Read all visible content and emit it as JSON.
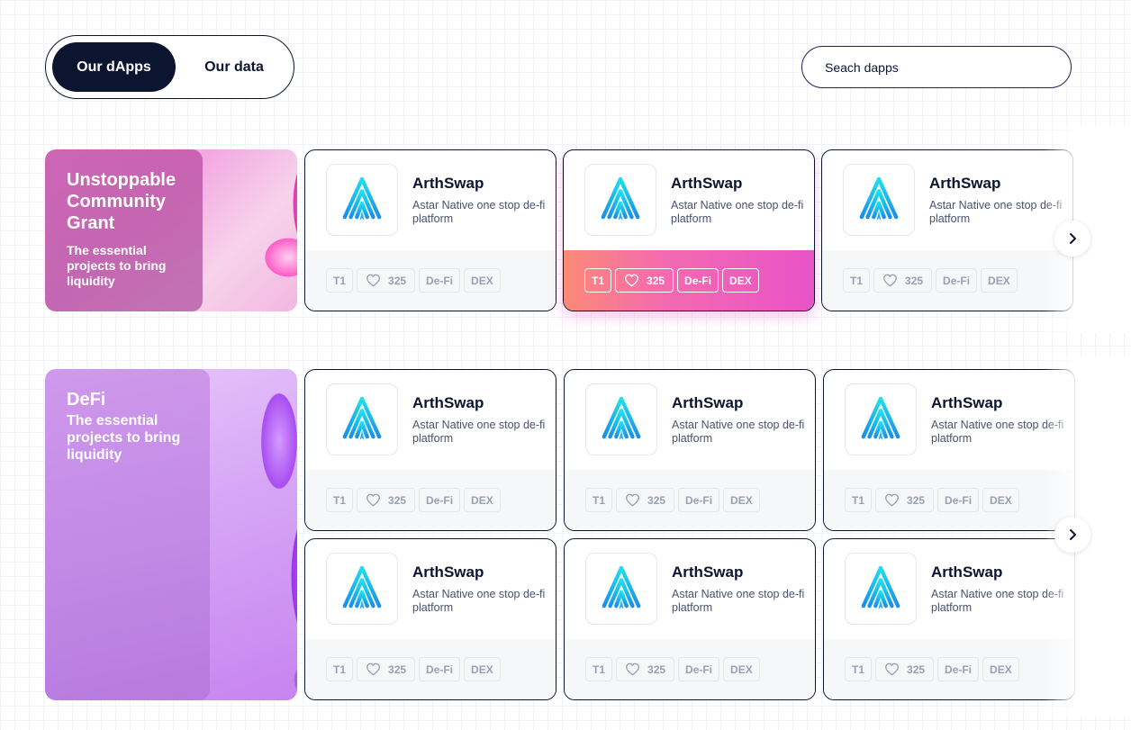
{
  "tabs": [
    {
      "label": "Our dApps",
      "active": true
    },
    {
      "label": "Our data",
      "active": false
    }
  ],
  "search": {
    "placeholder": "Seach dapps"
  },
  "featured": [
    {
      "title": "Unstoppable Community Grant",
      "subtitle": "The essential projects to bring liquidity"
    },
    {
      "title": "DeFi",
      "subtitle": "The essential projects to bring liquidity"
    }
  ],
  "card": {
    "name": "ArthSwap",
    "description": "Astar Native one stop de-fi platform",
    "tier": "T1",
    "likes": "325",
    "category": "De-Fi",
    "type": "DEX",
    "accent_gradient": [
      "#fb8a76",
      "#f46ab0",
      "#e853c8"
    ]
  },
  "icons": {
    "logo": "arthswap-logo-icon",
    "like": "heart-icon",
    "next": "chevron-right-icon"
  },
  "colors": {
    "primary": "#0b1530",
    "logo_gradient": [
      "#1ee0ec",
      "#1a8ee8"
    ]
  }
}
